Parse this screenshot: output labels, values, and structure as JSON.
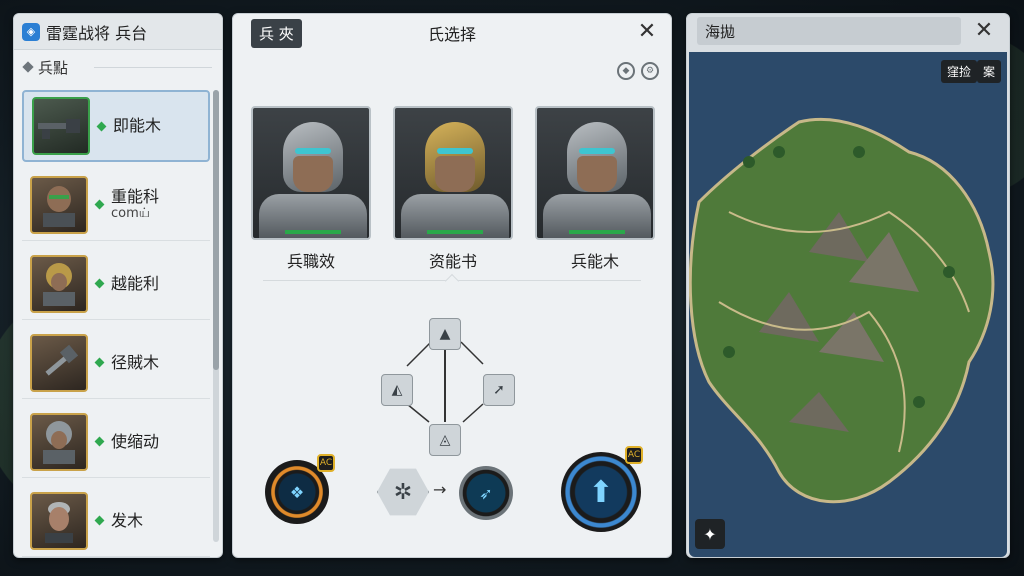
{
  "left_panel": {
    "title": "雷霆战将 兵台",
    "section_label": "兵點",
    "units": [
      {
        "name": "即能木",
        "sub": "",
        "selected": true
      },
      {
        "name": "重能科",
        "sub": "comய்",
        "selected": false
      },
      {
        "name": "越能利",
        "sub": "",
        "selected": false
      },
      {
        "name": "径賊木",
        "sub": "",
        "selected": false
      },
      {
        "name": "使缩动",
        "sub": "",
        "selected": false
      },
      {
        "name": "发木",
        "sub": "",
        "selected": false
      }
    ]
  },
  "center_panel": {
    "tab_label": "兵 夾",
    "title": "氏选择",
    "close_glyph": "✕",
    "portraits": [
      {
        "name": "兵職效"
      },
      {
        "name": "资能书"
      },
      {
        "name": "兵能木"
      }
    ],
    "skill_badges": [
      "AC",
      "AC"
    ]
  },
  "right_panel": {
    "title": "海拋",
    "close_glyph": "✕",
    "map_buttons": [
      "窪捡",
      "案"
    ]
  },
  "colors": {
    "accent_blue": "#2b7fd4",
    "selection_green": "#2fa84f",
    "badge_gold": "#e0b12a",
    "visor_cyan": "#3ec5d0"
  }
}
